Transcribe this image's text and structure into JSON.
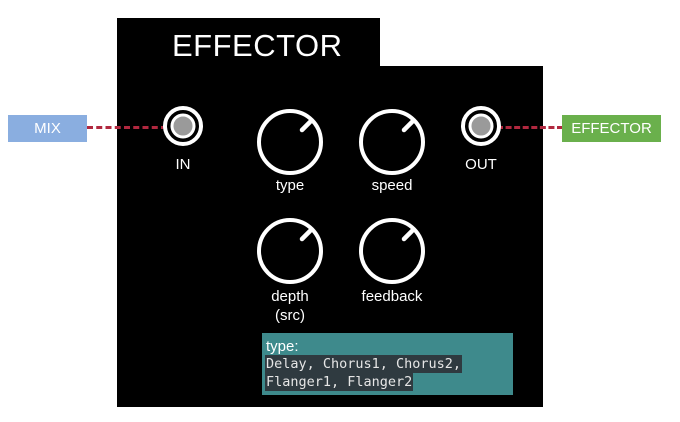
{
  "module": {
    "title": "EFFECTOR"
  },
  "connections": {
    "input_source": "MIX",
    "output_target": "EFFECTOR"
  },
  "jacks": {
    "in_label": "IN",
    "out_label": "OUT"
  },
  "knobs": [
    {
      "label": "type"
    },
    {
      "label": "speed"
    },
    {
      "label": "depth",
      "sublabel": "(src)"
    },
    {
      "label": "feedback"
    }
  ],
  "tooltip": {
    "title": "type:",
    "line1": "Delay, Chorus1, Chorus2,",
    "line2": "Flanger1, Flanger2"
  },
  "colors": {
    "panel": "#000000",
    "mix_tag": "#8aaee0",
    "effector_tag": "#6ab04c",
    "wire": "#b1283f",
    "tooltip_bg": "#3e8a8c"
  }
}
